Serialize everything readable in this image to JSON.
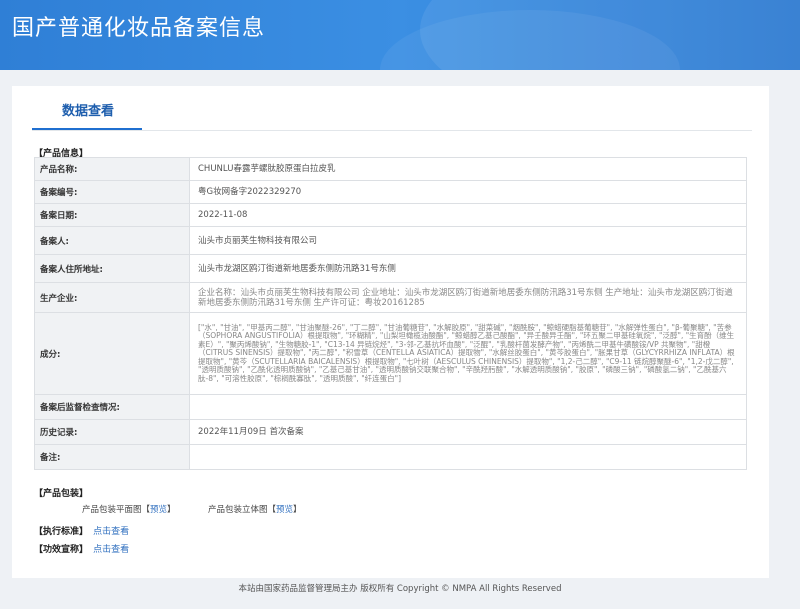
{
  "header": {
    "title": "国产普通化妆品备案信息"
  },
  "tab": {
    "label": "数据查看"
  },
  "sections": {
    "product_info": "【产品信息】",
    "packaging": "【产品包装】",
    "standard": "【执行标准】",
    "efficacy": "【功效宣称】"
  },
  "rows": [
    {
      "label": "产品名称:",
      "value": "CHUNLU春露芋螺肽胶原蛋白拉皮乳"
    },
    {
      "label": "备案编号:",
      "value": "粤G妆网备字2022329270"
    },
    {
      "label": "备案日期:",
      "value": "2022-11-08"
    },
    {
      "label": "备案人:",
      "value": "汕头市贞丽芙生物科技有限公司"
    },
    {
      "label": "备案人住所地址:",
      "value": "汕头市龙湖区鸥汀街道新地居委东侧防汛路31号东侧"
    },
    {
      "label": "生产企业:",
      "value": "企业名称：汕头市贞丽芙生物科技有限公司 企业地址：汕头市龙湖区鸥汀街道新地居委东侧防汛路31号东侧 生产地址：汕头市龙湖区鸥汀街道新地居委东侧防汛路31号东侧 生产许可证：粤妆20161285"
    },
    {
      "label": "成分:",
      "value": "[\"水\", \"甘油\", \"甲基丙二醇\", \"甘油聚醚-26\", \"丁二醇\", \"甘油葡糖苷\", \"水解胶原\", \"甜菜碱\", \"烟酰胺\", \"鲸蜡硬脂基葡糖苷\", \"水解弹性蛋白\", \"β-葡聚糖\", \"苦参（SOPHORA ANGUSTIFOLIA）根提取物\", \"环糊精\", \"山梨坦橄榄油酸酯\", \"鲸蜡醇乙基己酸酯\", \"异壬酸异壬酯\", \"环五聚二甲基硅氧烷\", \"泛醇\", \"生育酚（维生素E）\", \"聚丙烯酸钠\", \"生物糖胶-1\", \"C13-14 异链烷烃\", \"3-邻-乙基抗坏血酸\", \"泛醌\", \"乳酸杆菌发酵产物\", \"丙烯酰二甲基牛磺酸铵/VP 共聚物\", \"甜橙（CITRUS SINENSIS）提取物\", \"丙二醇\", \"积雪草（CENTELLA ASIATICA）提取物\", \"水解丝胶蛋白\", \"黄芩胶蛋白\", \"胀果甘草（GLYCYRRHIZA INFLATA）根提取物\", \"黄芩（SCUTELLARIA BAICALENSIS）根提取物\", \"七叶树（AESCULUS CHINENSIS）提取物\", \"1,2-己二醇\", \"C9-11 链烷醇聚醚-6\", \"1,2-戊二醇\", \"透明质酸钠\", \"乙酰化透明质酸钠\", \"乙基己基甘油\", \"透明质酸钠交联聚合物\", \"辛酰羟肟酸\", \"水解透明质酸钠\", \"胶原\", \"磷酸三钠\", \"磷酸氢二钠\", \"乙酰基六肽-8\", \"可溶性胶原\", \"棕榈酰寡肽\", \"透明质酸\", \"纤连蛋白\"]"
    },
    {
      "label": "备案后监督检查情况:",
      "value": ""
    },
    {
      "label": "历史记录:",
      "value": "2022年11月09日 首次备案"
    },
    {
      "label": "备注:",
      "value": ""
    }
  ],
  "packaging": {
    "flat_label": "产品包装平面图",
    "flat_link": "预览",
    "solid_label": "产品包装立体图",
    "solid_link": "预览"
  },
  "standard_link": "点击查看",
  "efficacy_link": "点击查看",
  "footer": "本站由国家药品监督管理局主办 版权所有 Copyright © NMPA All Rights Reserved"
}
